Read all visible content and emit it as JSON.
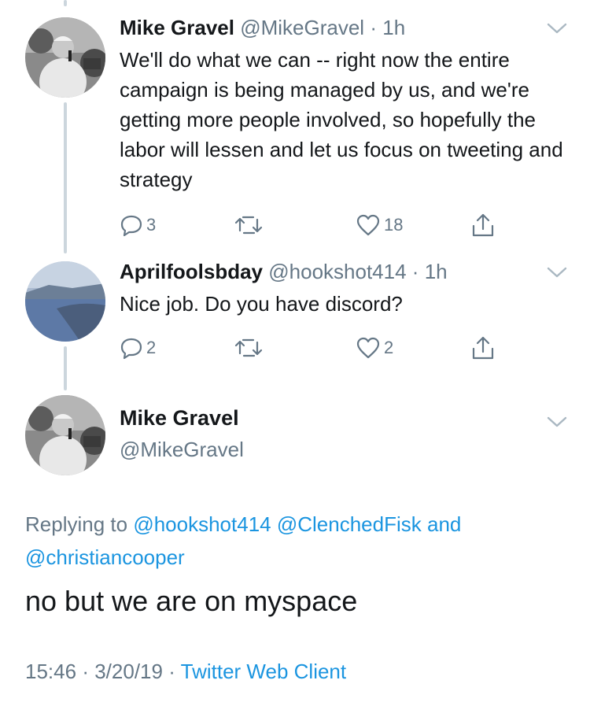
{
  "tweet1": {
    "name": "Mike Gravel",
    "handle": "@MikeGravel",
    "sep": "·",
    "time": "1h",
    "text": "We'll do what we can -- right now the entire campaign is being managed by us, and we're getting more people involved, so hopefully the labor will lessen and let us focus on tweeting and strategy",
    "replies": "3",
    "retweets": "",
    "likes": "18"
  },
  "tweet2": {
    "name": "Aprilfoolsbday",
    "handle": "@hookshot414",
    "sep": "·",
    "time": "1h",
    "text": "Nice job. Do you have discord?",
    "replies": "2",
    "retweets": "",
    "likes": "2"
  },
  "main": {
    "name": "Mike Gravel",
    "handle": "@MikeGravel",
    "replying_prefix": "Replying to",
    "mention1": "@hookshot414",
    "mention2": "@ClenchedFisk",
    "and": "and",
    "mention3": "@christiancooper",
    "text": "no but we are on myspace",
    "time": "15:46",
    "sep": "·",
    "date": "3/20/19",
    "source": "Twitter Web Client"
  },
  "colors": {
    "link": "#1b95e0",
    "secondary": "#657786",
    "thread": "#ccd6dd"
  }
}
